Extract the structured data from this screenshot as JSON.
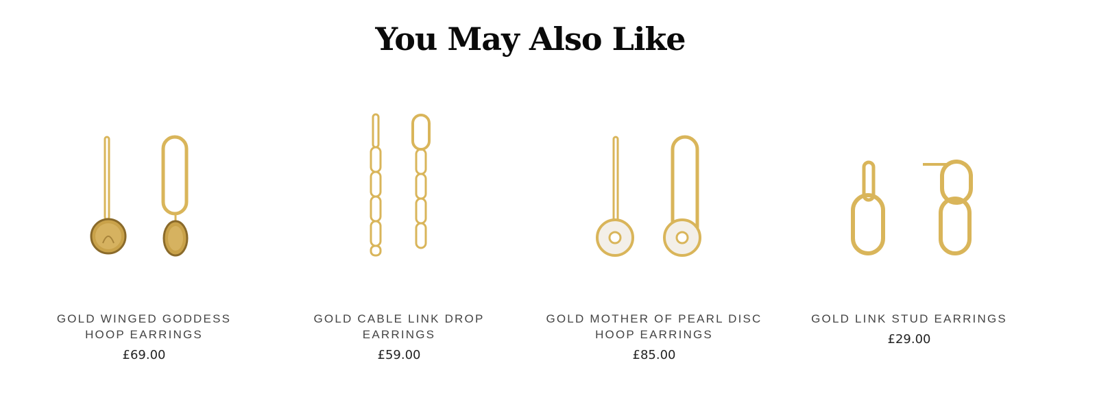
{
  "section": {
    "title": "You May Also Like"
  },
  "products": [
    {
      "name": "GOLD WINGED GODDESS HOOP EARRINGS",
      "price": "£69.00",
      "image_icon": "coin-hoop-earrings-icon"
    },
    {
      "name": "GOLD CABLE LINK DROP EARRINGS",
      "price": "£59.00",
      "image_icon": "chain-drop-earrings-icon"
    },
    {
      "name": "GOLD MOTHER OF PEARL DISC HOOP EARRINGS",
      "price": "£85.00",
      "image_icon": "pearl-disc-hoop-earrings-icon"
    },
    {
      "name": "GOLD LINK STUD EARRINGS",
      "price": "£29.00",
      "image_icon": "link-stud-earrings-icon"
    }
  ],
  "colors": {
    "gold": "#d9b55a",
    "gold_dark": "#b8923a",
    "pearl": "#f3efe8",
    "text": "#444444"
  }
}
